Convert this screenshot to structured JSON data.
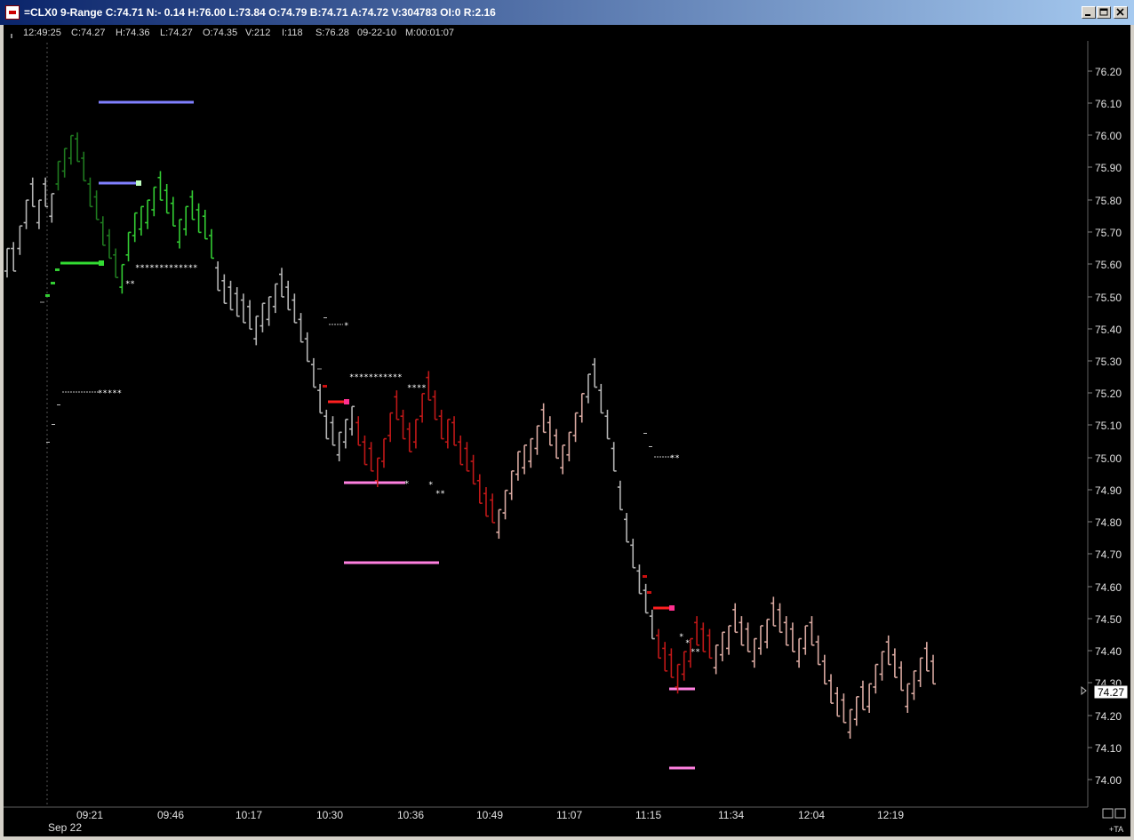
{
  "window": {
    "title": "=CLX0 9-Range C:74.71 N:- 0.14 H:76.00 L:73.84 O:74.79 B:74.71 A:74.72 V:304783 OI:0 R:2.16",
    "buttons": [
      "minimize",
      "maximize",
      "close"
    ]
  },
  "info_bar": {
    "time": "12:49:25",
    "close": "C:74.27",
    "high": "H:74.36",
    "low": "L:74.27",
    "open": "O:74.35",
    "volume": "V:212",
    "ticks": "I:118",
    "settle": "S:76.28",
    "date": "09-22-10",
    "elapsed": "M:00:01:07"
  },
  "price_axis": {
    "ticks": [
      "76.20",
      "76.10",
      "76.00",
      "75.90",
      "75.80",
      "75.70",
      "75.60",
      "75.50",
      "75.40",
      "75.30",
      "75.20",
      "75.10",
      "75.00",
      "74.90",
      "74.80",
      "74.70",
      "74.60",
      "74.50",
      "74.40",
      "74.30",
      "74.20",
      "74.10",
      "74.00"
    ],
    "last_price": "74.27"
  },
  "time_axis": {
    "date_label": "Sep 22",
    "ticks": [
      "09:21",
      "09:46",
      "10:17",
      "10:30",
      "10:36",
      "10:49",
      "11:07",
      "11:15",
      "11:34",
      "12:04",
      "12:19"
    ]
  },
  "corner_label": "+TA",
  "colors": {
    "background": "#000000",
    "bull_bright": "#33cc33",
    "bull_dark": "#1f7a1f",
    "neutral": "#b4b4b4",
    "bear": "#c01818",
    "bear_pale": "#d8a8a0",
    "resistance_line": "#8080ff",
    "support_line": "#ff80e0"
  },
  "chart_data": {
    "type": "ohlc",
    "symbol": "CLX0",
    "bar_type": "9-Range",
    "ylim": [
      73.95,
      76.25
    ],
    "series": [
      {
        "name": "price",
        "values": [
          75.65,
          75.58,
          75.72,
          75.8,
          75.78,
          75.8,
          75.78,
          75.82,
          75.92,
          75.96,
          76.0,
          75.92,
          75.86,
          75.78,
          75.74,
          75.66,
          75.62,
          75.56,
          75.6,
          75.7,
          75.76,
          75.78,
          75.8,
          75.84,
          75.8,
          75.76,
          75.72,
          75.74,
          75.78,
          75.74,
          75.7,
          75.68,
          75.62,
          75.52,
          75.48,
          75.46,
          75.44,
          75.42,
          75.4,
          75.44,
          75.48,
          75.5,
          75.54,
          75.5,
          75.46,
          75.42,
          75.36,
          75.3,
          75.22,
          75.14,
          75.06,
          75.04,
          75.08,
          75.12,
          75.16,
          75.04,
          74.98,
          74.96,
          75.0,
          75.06,
          75.14,
          75.12,
          75.06,
          75.02,
          75.12,
          75.2,
          75.18,
          75.12,
          75.06,
          75.12,
          75.04,
          74.98,
          74.96,
          74.92,
          74.86,
          74.82,
          74.8,
          74.84,
          74.9,
          74.96,
          75.02,
          75.04,
          75.06,
          75.1,
          75.08,
          75.04,
          75.0,
          75.04,
          75.08,
          75.14,
          75.2,
          75.26,
          75.22,
          75.14,
          75.06,
          74.96,
          74.84,
          74.74,
          74.66,
          74.58,
          74.52,
          74.44,
          74.38,
          74.34,
          74.32,
          74.36,
          74.4,
          74.44,
          74.42,
          74.4,
          74.38,
          74.42,
          74.46,
          74.48,
          74.46,
          74.42,
          74.4,
          74.44,
          74.48,
          74.5,
          74.48,
          74.46,
          74.42,
          74.4,
          74.44,
          74.48,
          74.42,
          74.36,
          74.3,
          74.24,
          74.2,
          74.18,
          74.22,
          74.26,
          74.22,
          74.3,
          74.36,
          74.4,
          74.36,
          74.32,
          74.28,
          74.3,
          74.34,
          74.38,
          74.34,
          74.3
        ]
      }
    ],
    "markers": [
      {
        "type": "resistance",
        "price": 76.1
      },
      {
        "type": "resistance",
        "price": 75.85
      },
      {
        "type": "support",
        "price": 74.92
      },
      {
        "type": "support",
        "price": 74.67
      },
      {
        "type": "support",
        "price": 74.03
      }
    ]
  }
}
